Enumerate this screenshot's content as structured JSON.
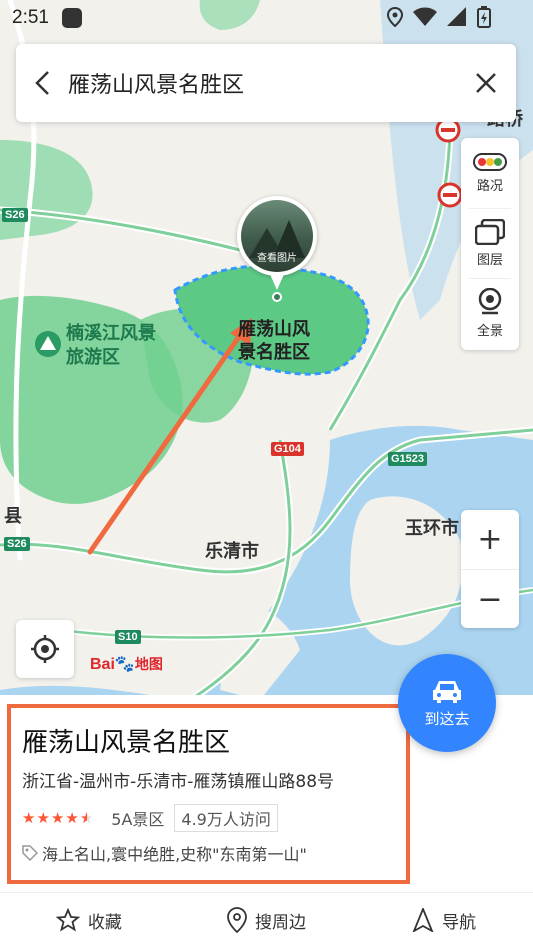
{
  "status_bar": {
    "time": "2:51",
    "icons": [
      "app-notification-icon",
      "location-icon",
      "wifi-icon",
      "signal-icon",
      "battery-icon"
    ]
  },
  "search": {
    "query": "雁荡山风景名胜区"
  },
  "tools": {
    "traffic": "路况",
    "layers": "图层",
    "panorama": "全景"
  },
  "map": {
    "photo_label": "查看图片",
    "labels": {
      "area_yandang": "雁荡山风\n景名胜区",
      "nanxijiang": "楠溪江风景\n旅游区",
      "yueqing": "乐清市",
      "yuhuan": "玉环市",
      "county": "县",
      "luqiao": "路桥"
    },
    "roads": [
      "S26",
      "S26",
      "G104",
      "G1523",
      "S10"
    ],
    "brand": {
      "text": "Bai",
      "text2": "地图"
    }
  },
  "go_button": {
    "label": "到这去"
  },
  "place": {
    "name": "雁荡山风景名胜区",
    "address": "浙江省-温州市-乐清市-雁荡镇雁山路88号",
    "rating_stars": 4.5,
    "grade": "5A景区",
    "visits": "4.9万人访问",
    "tags": "海上名山,寰中绝胜,史称\"东南第一山\""
  },
  "bottom_nav": {
    "favorite": "收藏",
    "nearby": "搜周边",
    "navigate": "导航"
  },
  "colors": {
    "accent": "#3385ff",
    "highlight_border": "#f06a3f",
    "park_green": "#6fcf8f",
    "water": "#aad4f0",
    "star": "#ff5533"
  }
}
